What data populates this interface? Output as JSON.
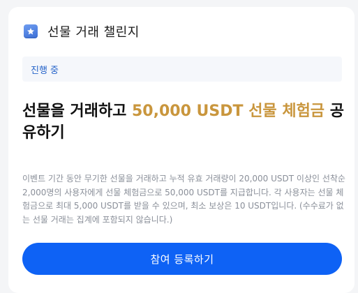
{
  "card": {
    "icon": "star-badge-icon",
    "title": "선물 거래 챌린지"
  },
  "status": {
    "label": "진행 중"
  },
  "headline": {
    "prefix": "선물을 거래하고 ",
    "highlight": "50,000 USDT 선물 체험금",
    "suffix": " 공유하기",
    "highlight_color": "#c9963d"
  },
  "description": "이벤트 기간 동안 무기한 선물을 거래하고 누적 유효 거래량이 20,000 USDT 이상인 선착순 2,000명의 사용자에게 선물 체험금으로 50,000 USDT를 지급합니다. 각 사용자는 선물 체험금으로 최대 5,000 USDT를 받을 수 있으며, 최소 보상은 10 USDT입니다. (수수료가 없는 선물 거래는 집계에 포함되지 않습니다.)",
  "cta": {
    "label": "참여 등록하기",
    "color": "#0e62f5"
  }
}
